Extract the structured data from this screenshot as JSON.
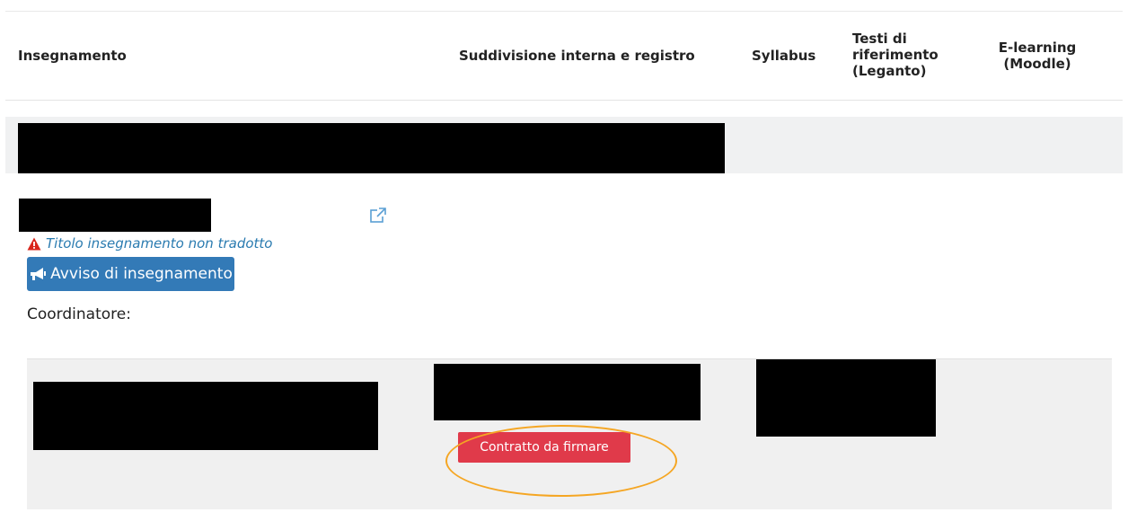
{
  "table": {
    "headers": {
      "insegnamento": "Insegnamento",
      "suddivisione": "Suddivisione interna e registro",
      "syllabus": "Syllabus",
      "testi": "Testi di riferimento (Leganto)",
      "elearning": "E-learning (Moodle)"
    }
  },
  "course": {
    "warning_text": "Titolo insegnamento non tradotto",
    "avviso_button_label": "Avviso di insegnamento",
    "coordinatore_label": "Coordinatore:",
    "contratto_button_label": "Contratto da firmare"
  },
  "colors": {
    "primary_button": "#337ab7",
    "danger_button": "#e03a4a",
    "warning_icon": "#d9261c",
    "highlight": "#f5a623",
    "link_icon": "#5a9fd4"
  },
  "icons": {
    "external_link": "external-link-icon",
    "warning": "warning-triangle-icon",
    "megaphone": "megaphone-icon"
  }
}
